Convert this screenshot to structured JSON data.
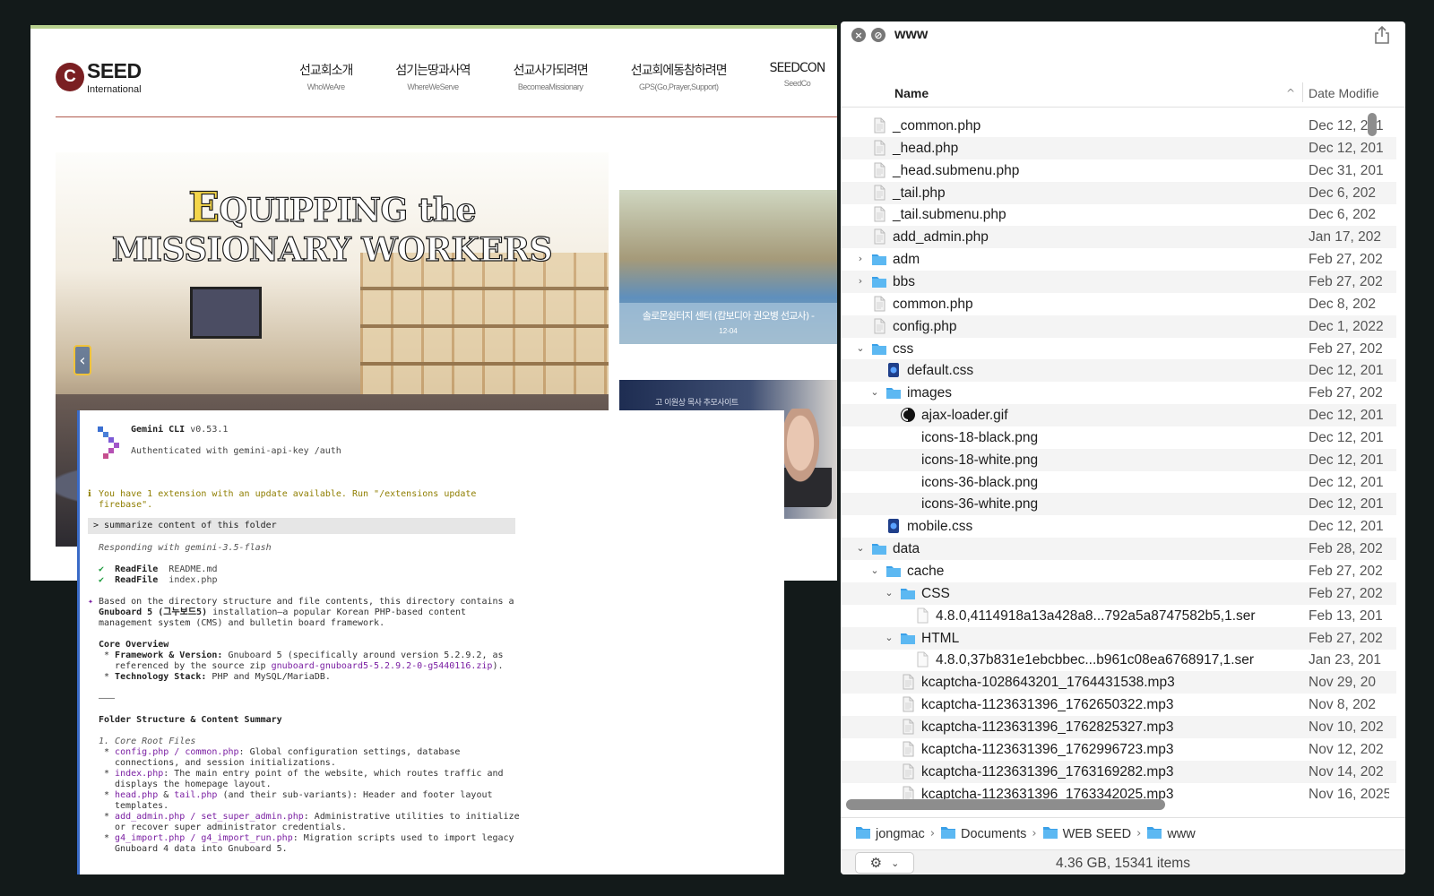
{
  "site": {
    "logo_letter": "C",
    "logo_name": "SEED",
    "logo_sub": "International",
    "nav": [
      {
        "ko": "선교회소개",
        "en": "WhoWeAre"
      },
      {
        "ko": "섬기는땅과사역",
        "en": "WhereWeServe"
      },
      {
        "ko": "선교사가되려면",
        "en": "BecomeaMissionary"
      },
      {
        "ko": "선교회에동참하려면",
        "en": "GPS(Go,Prayer,Support)"
      },
      {
        "ko": "SEEDCON",
        "en": "SeedCo"
      }
    ],
    "slide": {
      "line1": "EQUIPPING the",
      "line2": "MISSIONARY WORKERS"
    },
    "card1": {
      "title": "솔로몬쉼터지 센터 (캄보디아 권오병 선교사) -",
      "date": "12-04"
    },
    "card2": {
      "text": "고 이원상 목사 추모사이트"
    }
  },
  "terminal": {
    "name": "Gemini CLI",
    "version": "v0.53.1",
    "auth": "Authenticated with gemini-api-key /auth",
    "notice_1": "You have 1 extension with an update available. Run \"/extensions update",
    "notice_2": "firebase\".",
    "prompt": "> summarize content of this folder",
    "responding": "Responding with gemini-3.5-flash",
    "tool1_name": "ReadFile",
    "tool1_arg": "README.md",
    "tool2_name": "ReadFile",
    "tool2_arg": "index.php",
    "p1": "Based on the directory structure and file contents, this directory contains a",
    "p2_bold": "Gnuboard 5 (그누보드5)",
    "p2_rest": " installation—a popular Korean PHP-based content",
    "p3": "management system (CMS) and bulletin board framework.",
    "h_core": "Core Overview",
    "fw_label": "Framework & Version:",
    "fw_rest": " Gnuboard 5 (specifically around version 5.2.9.2, as",
    "fw_2a": "referenced by the source zip ",
    "fw_2b": "gnuboard-gnuboard5-5.2.9.2-0-g5440116.zip",
    "fw_2c": ").",
    "ts_label": "Technology Stack:",
    "ts_rest": " PHP and MySQL/MariaDB.",
    "rule": "———",
    "h_folder": "Folder Structure & Content Summary",
    "sub1": "1. Core Root Files",
    "i1_code": "config.php / common.php",
    "i1_rest": ": Global configuration settings, database",
    "i1_2": "connections, and session initializations.",
    "i2_code": "index.php",
    "i2_rest": ": The main entry point of the website, which routes traffic and",
    "i2_2": "displays the homepage layout.",
    "i3_code1": "head.php",
    "i3_amp": " & ",
    "i3_code2": "tail.php",
    "i3_rest": " (and their sub-variants): Header and footer layout",
    "i3_2": "templates.",
    "i4_code": "add_admin.php / set_super_admin.php",
    "i4_rest": ": Administrative utilities to initialize",
    "i4_2": "or recover super administrator credentials.",
    "i5_code": "g4_import.php / g4_import_run.php",
    "i5_rest": ": Migration scripts used to import legacy",
    "i5_2": "Gnuboard 4 data into Gnuboard 5."
  },
  "finder": {
    "title": "www",
    "col_name": "Name",
    "col_date": "Date Modifie",
    "rows": [
      {
        "name": "_common.php",
        "date": "Dec 12, 201",
        "type": "doc",
        "indent": 0
      },
      {
        "name": "_head.php",
        "date": "Dec 12, 201",
        "type": "doc",
        "indent": 0
      },
      {
        "name": "_head.submenu.php",
        "date": "Dec 31, 201",
        "type": "doc",
        "indent": 0
      },
      {
        "name": "_tail.php",
        "date": "Dec 6, 202",
        "type": "doc",
        "indent": 0
      },
      {
        "name": "_tail.submenu.php",
        "date": "Dec 6, 202",
        "type": "doc",
        "indent": 0
      },
      {
        "name": "add_admin.php",
        "date": "Jan 17, 202",
        "type": "doc",
        "indent": 0
      },
      {
        "name": "adm",
        "date": "Feb 27, 202",
        "type": "folder",
        "indent": 0,
        "chev": "›"
      },
      {
        "name": "bbs",
        "date": "Feb 27, 202",
        "type": "folder",
        "indent": 0,
        "chev": "›"
      },
      {
        "name": "common.php",
        "date": "Dec 8, 202",
        "type": "doc",
        "indent": 0
      },
      {
        "name": "config.php",
        "date": "Dec 1, 2022",
        "type": "doc",
        "indent": 0
      },
      {
        "name": "css",
        "date": "Feb 27, 202",
        "type": "folder",
        "indent": 0,
        "chev": "⌄"
      },
      {
        "name": "default.css",
        "date": "Dec 12, 201",
        "type": "css",
        "indent": 1
      },
      {
        "name": "images",
        "date": "Feb 27, 202",
        "type": "folder",
        "indent": 1,
        "chev": "⌄"
      },
      {
        "name": "ajax-loader.gif",
        "date": "Dec 12, 201",
        "type": "gif",
        "indent": 2
      },
      {
        "name": "icons-18-black.png",
        "date": "Dec 12, 201",
        "type": "blank",
        "indent": 2
      },
      {
        "name": "icons-18-white.png",
        "date": "Dec 12, 201",
        "type": "blank",
        "indent": 2
      },
      {
        "name": "icons-36-black.png",
        "date": "Dec 12, 201",
        "type": "blank",
        "indent": 2
      },
      {
        "name": "icons-36-white.png",
        "date": "Dec 12, 201",
        "type": "blank",
        "indent": 2
      },
      {
        "name": "mobile.css",
        "date": "Dec 12, 201",
        "type": "css",
        "indent": 1
      },
      {
        "name": "data",
        "date": "Feb 28, 202",
        "type": "folder",
        "indent": 0,
        "chev": "⌄"
      },
      {
        "name": "cache",
        "date": "Feb 27, 202",
        "type": "folder",
        "indent": 1,
        "chev": "⌄"
      },
      {
        "name": "CSS",
        "date": "Feb 27, 202",
        "type": "folder",
        "indent": 2,
        "chev": "⌄"
      },
      {
        "name": "4.8.0,4114918a13a428a8...792a5a8747582b5,1.ser",
        "date": "Feb 13, 201",
        "type": "page",
        "indent": 3
      },
      {
        "name": "HTML",
        "date": "Feb 27, 202",
        "type": "folder",
        "indent": 2,
        "chev": "⌄"
      },
      {
        "name": "4.8.0,37b831e1ebcbbec...b961c08ea6768917,1.ser",
        "date": "Jan 23, 201",
        "type": "page",
        "indent": 3
      },
      {
        "name": "kcaptcha-1028643201_1764431538.mp3",
        "date": "Nov 29, 20",
        "type": "doc",
        "indent": 2
      },
      {
        "name": "kcaptcha-1123631396_1762650322.mp3",
        "date": "Nov 8, 202",
        "type": "doc",
        "indent": 2
      },
      {
        "name": "kcaptcha-1123631396_1762825327.mp3",
        "date": "Nov 10, 202",
        "type": "doc",
        "indent": 2
      },
      {
        "name": "kcaptcha-1123631396_1762996723.mp3",
        "date": "Nov 12, 202",
        "type": "doc",
        "indent": 2
      },
      {
        "name": "kcaptcha-1123631396_1763169282.mp3",
        "date": "Nov 14, 202",
        "type": "doc",
        "indent": 2
      },
      {
        "name": "kcaptcha-1123631396_1763342025.mp3",
        "date": "Nov 16, 2025",
        "type": "doc",
        "indent": 2
      }
    ],
    "path": [
      "jongmac",
      "Documents",
      "WEB SEED",
      "www"
    ],
    "status": "4.36 GB, 15341 items"
  }
}
